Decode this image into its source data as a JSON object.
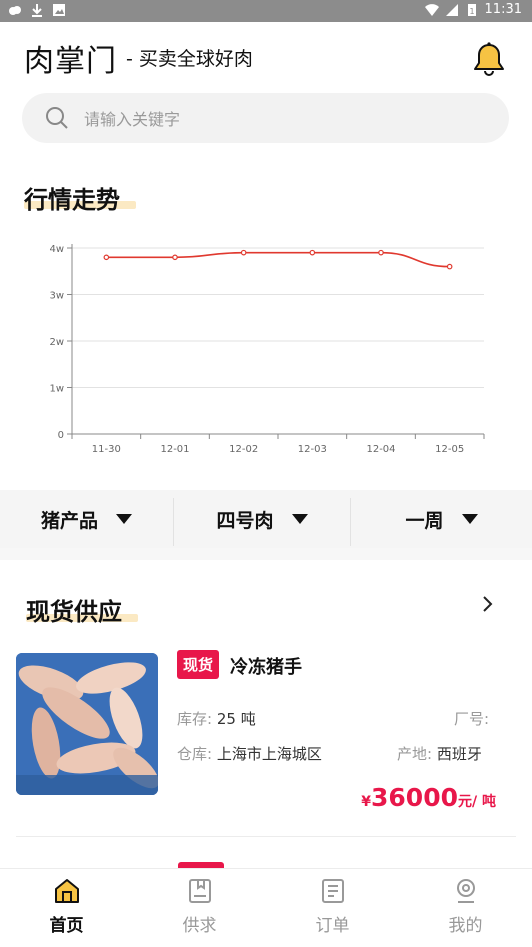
{
  "status_bar": {
    "time": "11:31",
    "battery": "1"
  },
  "header": {
    "brand": "肉掌门",
    "slogan": "- 买卖全球好肉"
  },
  "search": {
    "placeholder": "请输入关键字"
  },
  "market": {
    "title": "行情走势"
  },
  "chart_data": {
    "type": "line",
    "categories": [
      "11-30",
      "12-01",
      "12-02",
      "12-03",
      "12-04",
      "12-05"
    ],
    "values": [
      38000,
      38000,
      39000,
      39000,
      39000,
      36000
    ],
    "y_ticks": [
      "0",
      "1w",
      "2w",
      "3w",
      "4w"
    ],
    "ylim": [
      0,
      40000
    ],
    "grid": true,
    "color": "#e0392f"
  },
  "filters": {
    "category": "猪产品",
    "part": "四号肉",
    "period": "一周"
  },
  "supply": {
    "title": "现货供应"
  },
  "product": {
    "badge": "现货",
    "name": "冷冻猪手",
    "stock_label": "库存:",
    "stock_value": "25 吨",
    "factory_label": "厂号:",
    "factory_value": "",
    "warehouse_label": "仓库:",
    "warehouse_value": "上海市上海城区",
    "origin_label": "产地:",
    "origin_value": "西班牙",
    "currency": "¥",
    "price": "36000",
    "unit": "元/ 吨"
  },
  "tabs": [
    {
      "label": "首页",
      "icon": "home-icon",
      "active": true
    },
    {
      "label": "供求",
      "icon": "supply-icon",
      "active": false
    },
    {
      "label": "订单",
      "icon": "order-icon",
      "active": false
    },
    {
      "label": "我的",
      "icon": "profile-icon",
      "active": false
    }
  ],
  "colors": {
    "accent": "#e8174a",
    "underline": "#fbe9c3",
    "chart_line": "#e0392f"
  }
}
